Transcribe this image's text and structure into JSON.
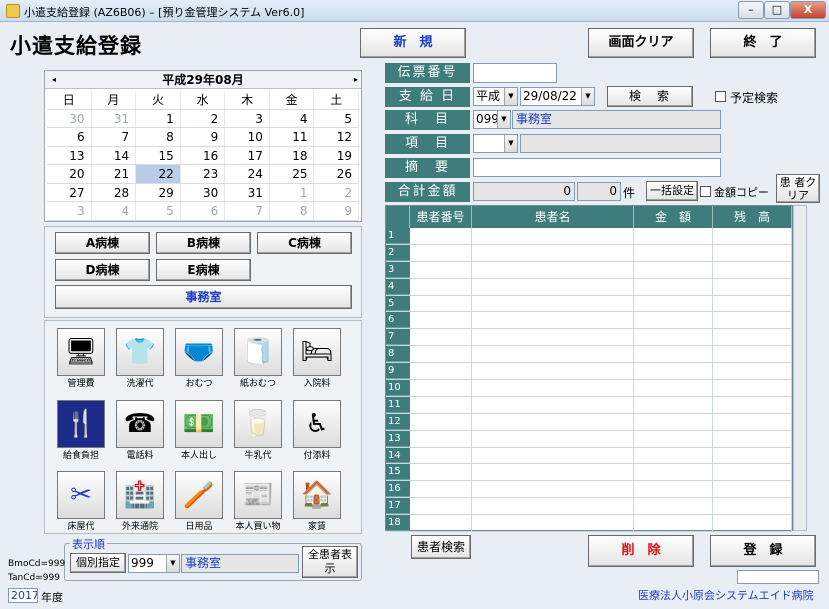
{
  "window": {
    "title": "小遣支給登録 (AZ6B06) – [預り金管理システム Ver6.0]",
    "min_glyph": "–",
    "max_glyph": "□",
    "close_glyph": "X"
  },
  "header": {
    "app_title": "小遣支給登録",
    "new_label": "新　規",
    "clear_label": "画面クリア",
    "exit_label": "終　了"
  },
  "calendar": {
    "title": "平成29年08月",
    "prev": "◂",
    "next": "▸",
    "weekdays": [
      "日",
      "月",
      "火",
      "水",
      "木",
      "金",
      "土"
    ],
    "weeks": [
      [
        "30",
        "31",
        "1",
        "2",
        "3",
        "4",
        "5"
      ],
      [
        "6",
        "7",
        "8",
        "9",
        "10",
        "11",
        "12"
      ],
      [
        "13",
        "14",
        "15",
        "16",
        "17",
        "18",
        "19"
      ],
      [
        "20",
        "21",
        "22",
        "23",
        "24",
        "25",
        "26"
      ],
      [
        "27",
        "28",
        "29",
        "30",
        "31",
        "1",
        "2"
      ],
      [
        "3",
        "4",
        "5",
        "6",
        "7",
        "8",
        "9"
      ]
    ],
    "selected": "22"
  },
  "wards": {
    "a": "A病棟",
    "b": "B病棟",
    "c": "C病棟",
    "d": "D病棟",
    "e": "E病棟",
    "office": "事務室"
  },
  "items": [
    {
      "label": "管理費",
      "icon": "computer-icon",
      "glyph": "🖥"
    },
    {
      "label": "洗濯代",
      "icon": "laundry-icon",
      "glyph": "👕"
    },
    {
      "label": "おむつ",
      "icon": "diaper-icon",
      "glyph": "🩲"
    },
    {
      "label": "紙おむつ",
      "icon": "paper-diaper-icon",
      "glyph": "🧻"
    },
    {
      "label": "入院料",
      "icon": "hospital-bed-icon",
      "glyph": "🛏"
    },
    {
      "label": "給食負担",
      "icon": "fork-knife-icon",
      "glyph": "🍴"
    },
    {
      "label": "電話料",
      "icon": "telephone-icon",
      "glyph": "☎"
    },
    {
      "label": "本人出し",
      "icon": "money-icon",
      "glyph": "💵"
    },
    {
      "label": "牛乳代",
      "icon": "milk-icon",
      "glyph": "🥛"
    },
    {
      "label": "付添料",
      "icon": "wheelchair-icon",
      "glyph": "♿"
    },
    {
      "label": "床屋代",
      "icon": "scissors-icon",
      "glyph": "✂"
    },
    {
      "label": "外来通院",
      "icon": "clinic-icon",
      "glyph": "🏥"
    },
    {
      "label": "日用品",
      "icon": "daily-goods-icon",
      "glyph": "🪥"
    },
    {
      "label": "本人買い物",
      "icon": "newspaper-icon",
      "glyph": "📰"
    },
    {
      "label": "家賃",
      "icon": "house-icon",
      "glyph": "🏠"
    }
  ],
  "order": {
    "legend": "表示順",
    "individual_label": "個別指定",
    "code_value": "999",
    "name_value": "事務室",
    "all_patients_label": "全患者表示"
  },
  "form": {
    "slip_label": "伝票番号",
    "slip_value": "",
    "date_label": "支 給 日",
    "era_value": "平成",
    "date_value": "29/08/22",
    "search_label": "検　索",
    "planned_search_label": "予定検索",
    "subject_label": "科　目",
    "subject_code": "099",
    "subject_name": "事務室",
    "item_label": "項　目",
    "item_code": "",
    "item_name": "",
    "memo_label": "摘　要",
    "memo_value": "",
    "total_label": "合計金額",
    "total_amount": "0",
    "count_value": "0",
    "count_unit": "件",
    "bulk_label": "一括設定",
    "amount_copy_label": "金額コピー",
    "patient_clear_label": "患 者クリア"
  },
  "grid": {
    "headers": [
      "患者番号",
      "患者名",
      "金　額",
      "残　高"
    ],
    "rows": [
      "1",
      "2",
      "3",
      "4",
      "5",
      "6",
      "7",
      "8",
      "9",
      "10",
      "11",
      "12",
      "13",
      "14",
      "15",
      "16",
      "17",
      "18"
    ]
  },
  "footer": {
    "patient_search_label": "患者検索",
    "delete_label": "削　除",
    "register_label": "登　録",
    "bmo": "BmoCd=999",
    "tan": "TanCd=999",
    "year_value": "2017",
    "year_unit": "年度",
    "org": "医療法人小原会システムエイド病院"
  }
}
